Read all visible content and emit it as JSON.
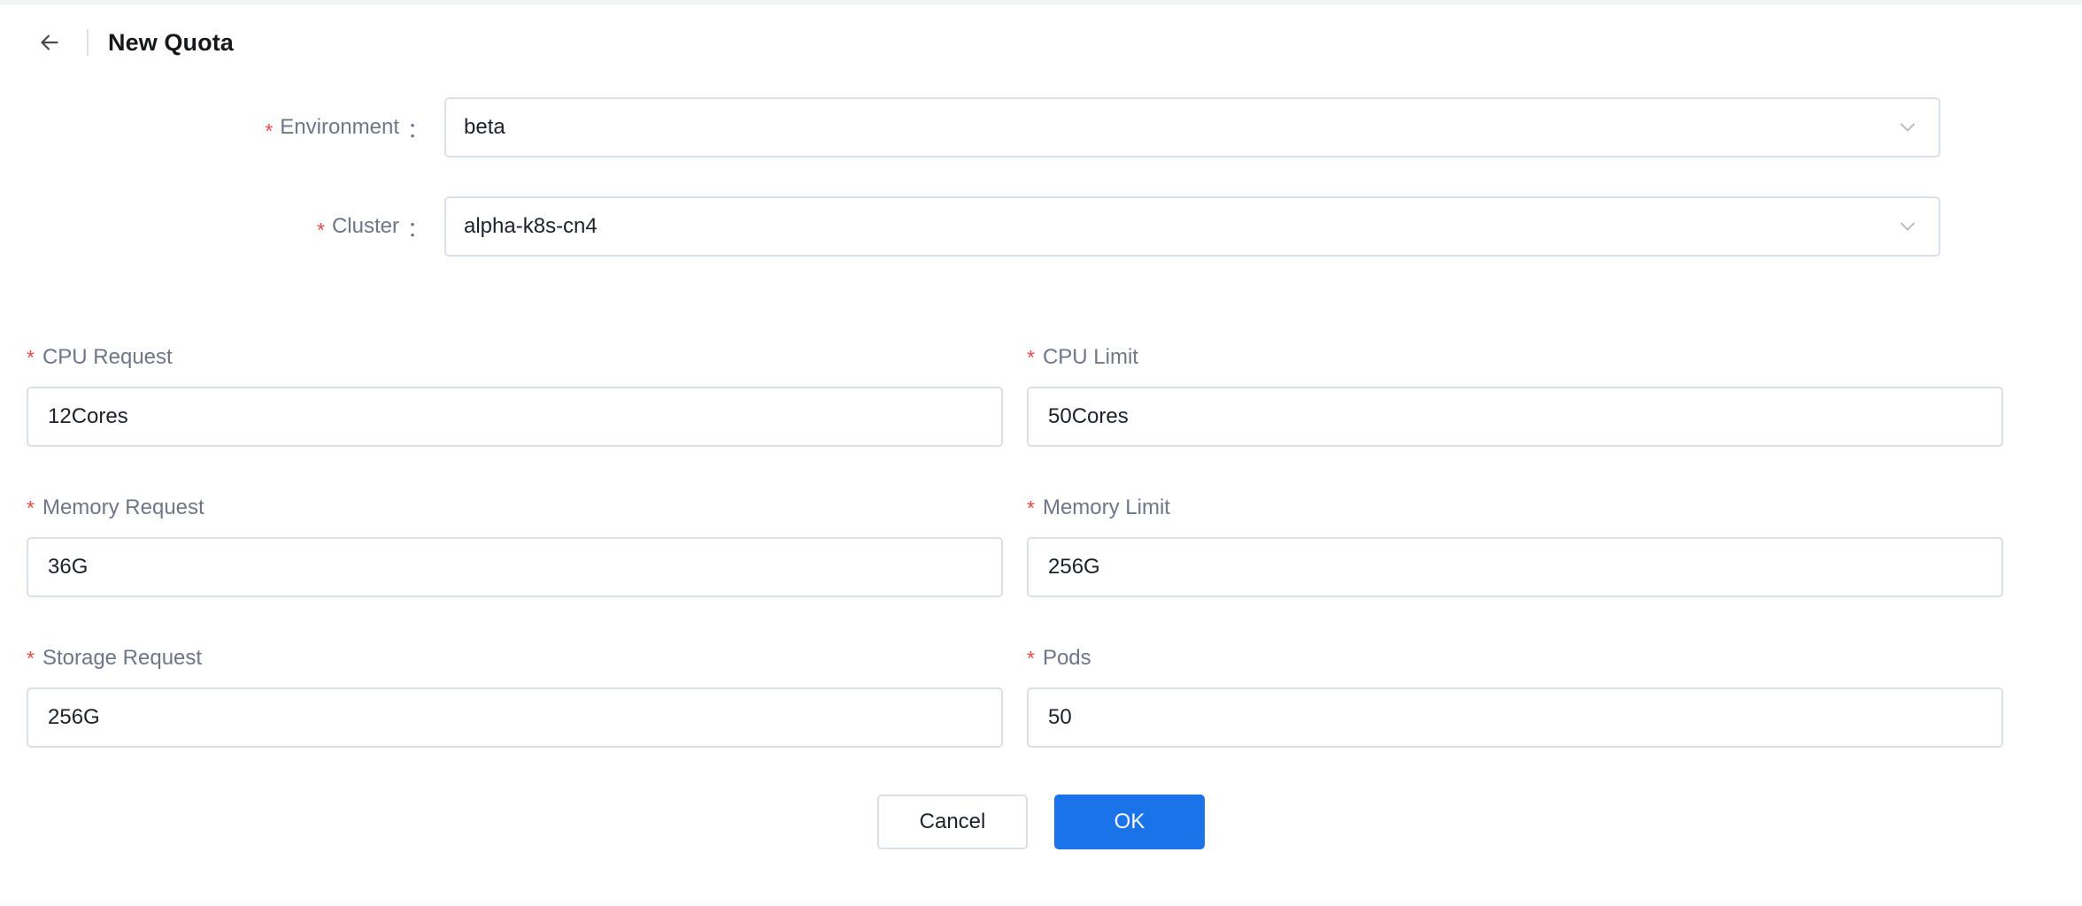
{
  "header": {
    "back_icon": "arrow-left-icon",
    "title": "New Quota"
  },
  "top_fields": [
    {
      "label": "Environment",
      "colon": "：",
      "required_marker": "*",
      "value": "beta",
      "chevron_icon": "chevron-down-icon"
    },
    {
      "label": "Cluster",
      "colon": "：",
      "required_marker": "*",
      "value": "alpha-k8s-cn4",
      "chevron_icon": "chevron-down-icon"
    }
  ],
  "grid_fields": {
    "cpu_request": {
      "label": "CPU Request",
      "required_marker": "*",
      "value": "12Cores"
    },
    "cpu_limit": {
      "label": "CPU Limit",
      "required_marker": "*",
      "value": "50Cores"
    },
    "memory_request": {
      "label": "Memory Request",
      "required_marker": "*",
      "value": "36G"
    },
    "memory_limit": {
      "label": "Memory Limit",
      "required_marker": "*",
      "value": "256G"
    },
    "storage_request": {
      "label": "Storage Request",
      "required_marker": "*",
      "value": "256G"
    },
    "pods": {
      "label": "Pods",
      "required_marker": "*",
      "value": "50"
    }
  },
  "footer": {
    "cancel_label": "Cancel",
    "ok_label": "OK"
  },
  "colors": {
    "primary": "#1a73e8",
    "required_star": "#e94a4a",
    "label_text": "#6e7687",
    "value_text": "#1d2129",
    "border": "#dcdfe6",
    "title_text": "#17181c"
  }
}
